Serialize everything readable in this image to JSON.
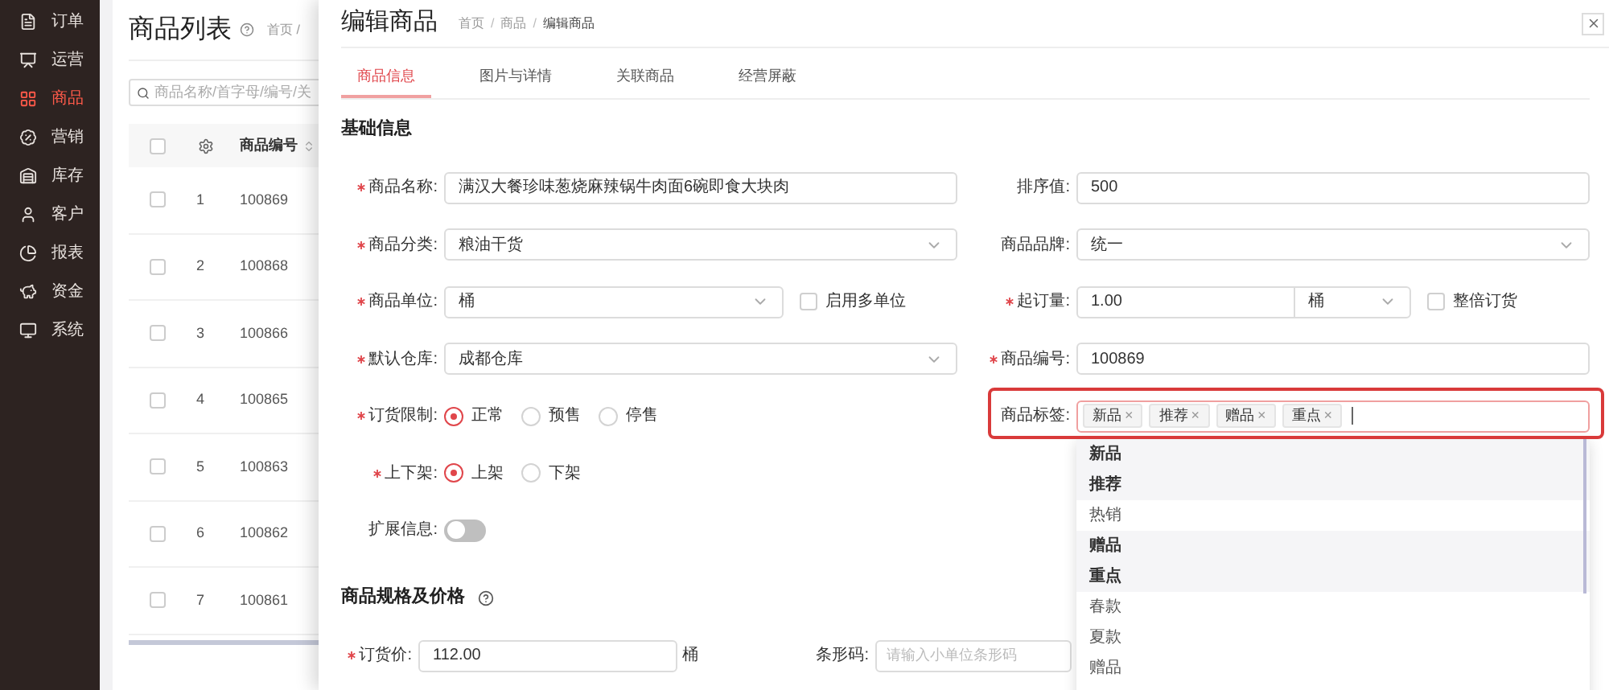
{
  "sidebar": {
    "items": [
      {
        "label": "订单",
        "selected": false
      },
      {
        "label": "运营",
        "selected": false
      },
      {
        "label": "商品",
        "selected": true
      },
      {
        "label": "营销",
        "selected": false
      },
      {
        "label": "库存",
        "selected": false
      },
      {
        "label": "客户",
        "selected": false
      },
      {
        "label": "报表",
        "selected": false
      },
      {
        "label": "资金",
        "selected": false
      },
      {
        "label": "系统",
        "selected": false
      }
    ]
  },
  "list_page": {
    "title": "商品列表",
    "breadcrumb": "首页 /",
    "search": {
      "placeholder": "商品名称/首字母/编号/关"
    },
    "table": {
      "select_all_checked": false,
      "columns": [
        "商品编号"
      ],
      "rows": [
        {
          "index": "1",
          "code": "100869",
          "checked": false
        },
        {
          "index": "2",
          "code": "100868",
          "checked": false
        },
        {
          "index": "3",
          "code": "100866",
          "checked": false
        },
        {
          "index": "4",
          "code": "100865",
          "checked": false
        },
        {
          "index": "5",
          "code": "100863",
          "checked": false
        },
        {
          "index": "6",
          "code": "100862",
          "checked": false
        },
        {
          "index": "7",
          "code": "100861",
          "checked": false
        }
      ]
    }
  },
  "modal": {
    "title": "编辑商品",
    "breadcrumb": [
      "首页",
      "商品",
      "编辑商品"
    ],
    "breadcrumb_separator": "/",
    "tabs": [
      {
        "label": "商品信息",
        "selected": true
      },
      {
        "label": "图片与详情",
        "selected": false
      },
      {
        "label": "关联商品",
        "selected": false
      },
      {
        "label": "经营屏蔽",
        "selected": false
      }
    ],
    "basic_info": {
      "title": "基础信息",
      "rows": [
        {
          "left": {
            "kind": "input",
            "label": "商品名称:",
            "required": true,
            "value": "满汉大餐珍味葱烧麻辣锅牛肉面6碗即食大块肉"
          },
          "right": {
            "kind": "input",
            "label": "排序值:",
            "required": false,
            "value": "500"
          }
        },
        {
          "left": {
            "kind": "select",
            "label": "商品分类:",
            "required": true,
            "value": "粮油干货"
          },
          "right": {
            "kind": "select",
            "label": "商品品牌:",
            "required": false,
            "value": "统一"
          }
        },
        {
          "left": {
            "kind": "select",
            "label": "商品单位:",
            "required": true,
            "value": "桶",
            "checkbox": {
              "label": "启用多单位",
              "checked": false
            }
          },
          "right": {
            "kind": "qty",
            "label": "起订量:",
            "required": true,
            "value": "1.00",
            "unit": "桶",
            "checkbox": {
              "label": "整倍订货",
              "checked": false
            }
          }
        },
        {
          "left": {
            "kind": "select",
            "label": "默认仓库:",
            "required": true,
            "value": "成都仓库"
          },
          "right": {
            "kind": "input",
            "label": "商品编号:",
            "required": true,
            "value": "100869"
          }
        },
        {
          "left": {
            "kind": "radio",
            "label": "订货限制:",
            "required": true,
            "options": [
              {
                "label": "正常",
                "selected": true
              },
              {
                "label": "预售",
                "selected": false
              },
              {
                "label": "停售",
                "selected": false
              }
            ]
          },
          "right": {
            "kind": "tags",
            "label": "商品标签:",
            "required": false,
            "highlighted": true,
            "tags": [
              "新品",
              "推荐",
              "赠品",
              "重点"
            ],
            "close_mark": "×",
            "dropdown": [
              {
                "label": "新品",
                "selected": true
              },
              {
                "label": "推荐",
                "selected": true
              },
              {
                "label": "热销",
                "selected": false
              },
              {
                "label": "赠品",
                "selected": true
              },
              {
                "label": "重点",
                "selected": true
              },
              {
                "label": "春款",
                "selected": false
              },
              {
                "label": "夏款",
                "selected": false
              },
              {
                "label": "赠品",
                "selected": false
              }
            ]
          }
        },
        {
          "left": {
            "kind": "radio",
            "label": "上下架:",
            "required": true,
            "options": [
              {
                "label": "上架",
                "selected": true
              },
              {
                "label": "下架",
                "selected": false
              }
            ]
          }
        },
        {
          "left": {
            "kind": "switch",
            "label": "扩展信息:",
            "required": false,
            "on": false
          }
        }
      ]
    },
    "pricing": {
      "title": "商品规格及价格",
      "price": {
        "label": "订货价:",
        "required": true,
        "value": "112.00",
        "unit": "桶"
      },
      "barcode": {
        "label": "条形码:",
        "required": false,
        "placeholder": "请输入小单位条形码"
      }
    }
  }
}
